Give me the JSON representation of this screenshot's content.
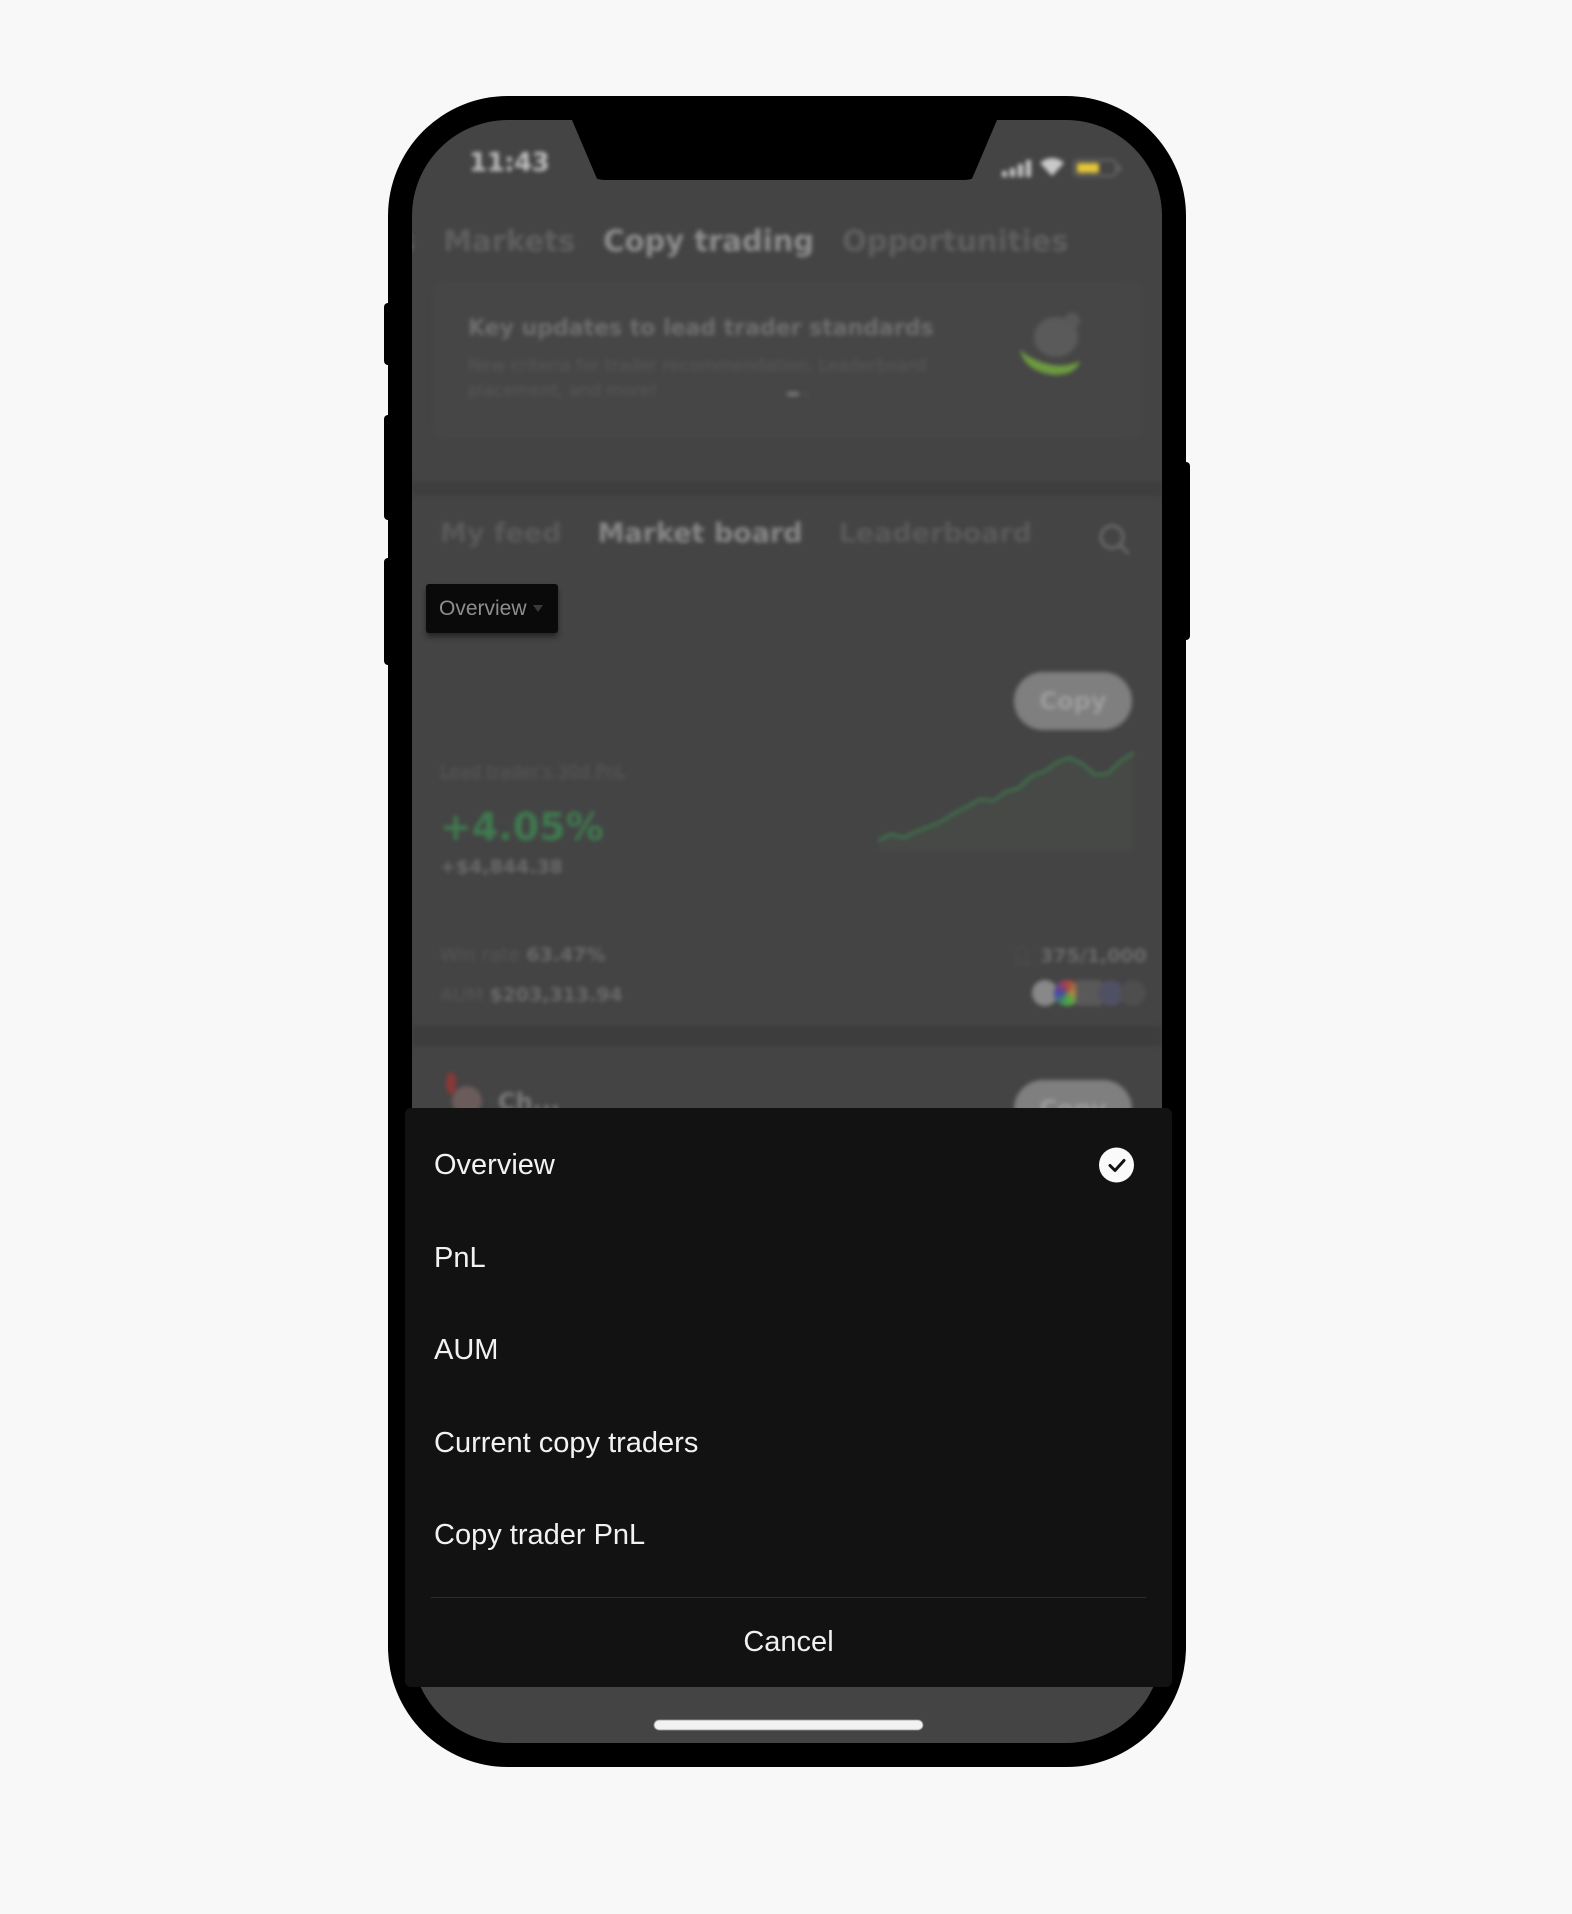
{
  "status_bar": {
    "time": "11:43",
    "signal_icon": "cellular-signal-icon",
    "wifi_icon": "wifi-icon",
    "battery_icon": "battery-icon",
    "battery_color": "#e4c53a"
  },
  "top_nav": {
    "tabs": [
      {
        "label": "s"
      },
      {
        "label": "Markets"
      },
      {
        "label": "Copy trading",
        "active": true
      },
      {
        "label": "Opportunities"
      }
    ]
  },
  "banner": {
    "title": "Key updates to lead trader standards",
    "subtitle": "New criteria for trader recommendation, Leaderboard placement, and more!",
    "illustration_icon": "trophy-base-icon",
    "page_count": 2,
    "active_page": 1
  },
  "sub_nav": {
    "tabs": [
      {
        "label": "My feed"
      },
      {
        "label": "Market board",
        "active": true
      },
      {
        "label": "Leaderboard"
      }
    ],
    "search_icon": "search-icon"
  },
  "filter": {
    "selected_label": "Overview"
  },
  "trader_card": {
    "copy_label": "Copy",
    "pnl_label": "Lead trader's 30d PnL",
    "pnl_percent": "+4.05%",
    "pnl_amount": "+$4,844.38",
    "pnl_color": "#3f7a4f",
    "win_rate_label": "Win rate",
    "win_rate_value": "63.47%",
    "aum_label": "AUM",
    "aum_value": "$203,313.94",
    "copiers_value": "375/1,000",
    "sparkline": [
      0.05,
      0.12,
      0.08,
      0.15,
      0.2,
      0.26,
      0.35,
      0.42,
      0.5,
      0.48,
      0.58,
      0.62,
      0.75,
      0.8,
      0.9,
      0.95,
      0.88,
      0.76,
      0.78,
      0.92,
      1.0
    ]
  },
  "second_card": {
    "name": "Ch...",
    "copy_label": "Copy"
  },
  "action_sheet": {
    "options": [
      {
        "label": "Overview",
        "selected": true
      },
      {
        "label": "PnL",
        "selected": false
      },
      {
        "label": "AUM",
        "selected": false
      },
      {
        "label": "Current copy traders",
        "selected": false
      },
      {
        "label": "Copy trader PnL",
        "selected": false
      }
    ],
    "cancel_label": "Cancel"
  }
}
